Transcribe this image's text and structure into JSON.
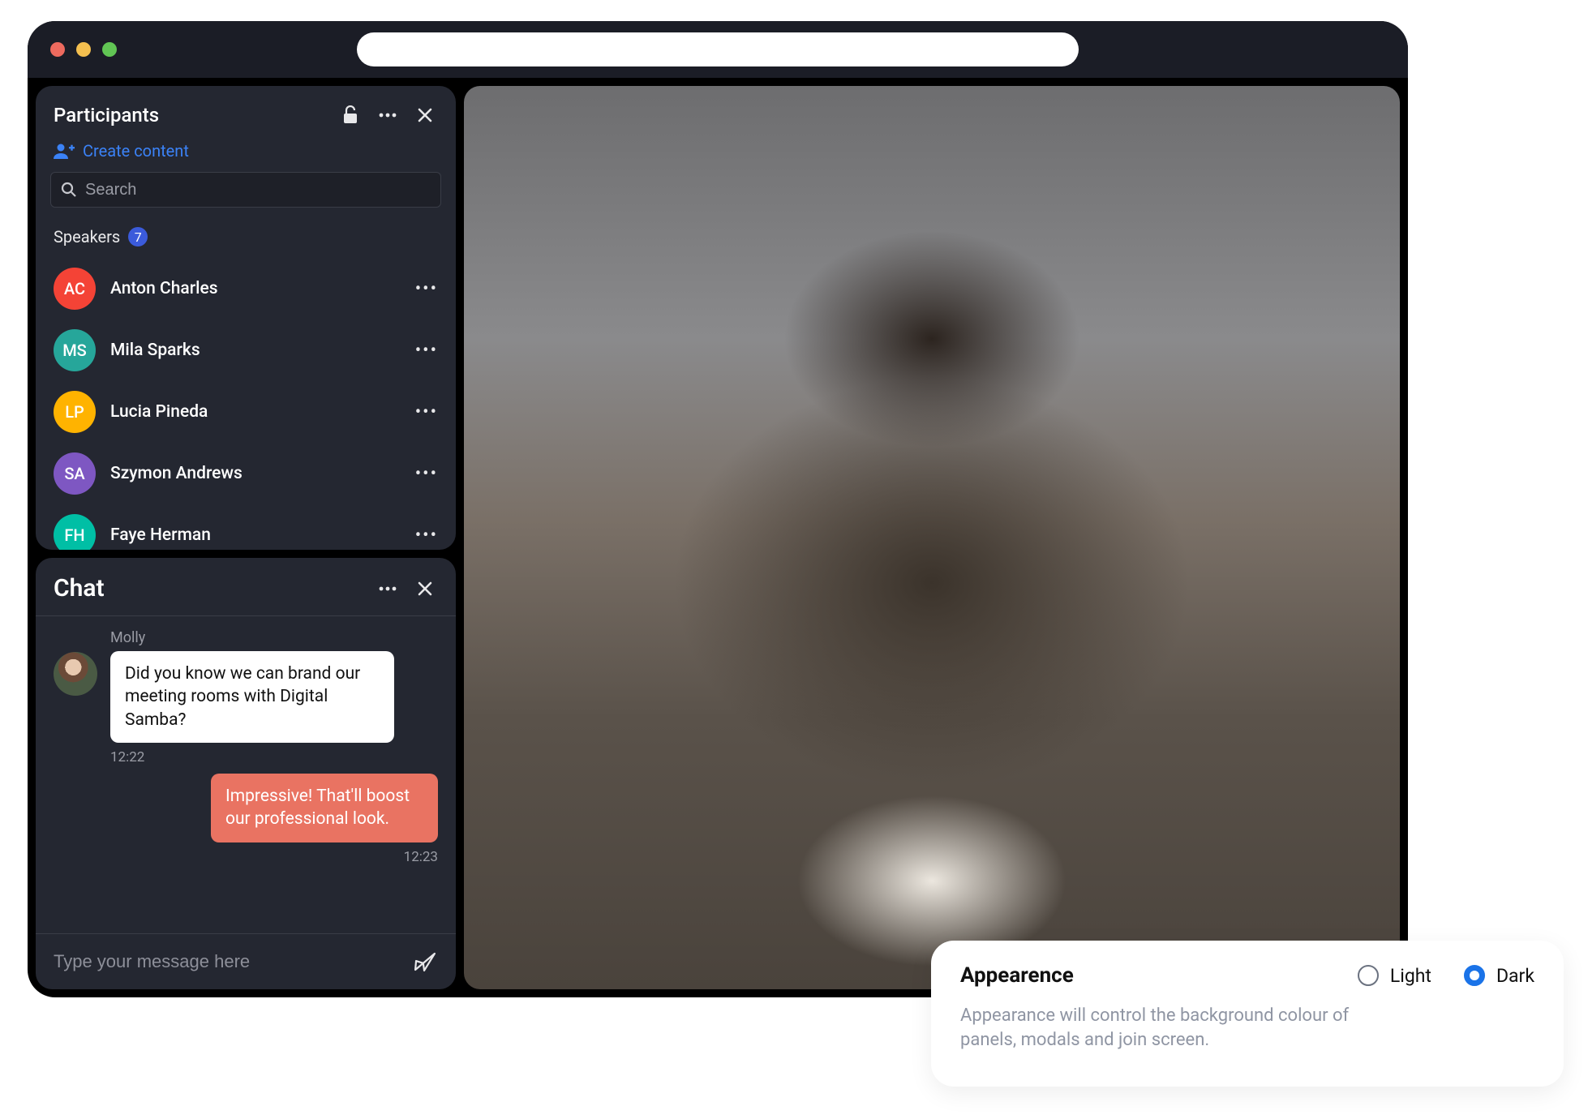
{
  "participants": {
    "title": "Participants",
    "create_label": "Create content",
    "search_placeholder": "Search",
    "section_label": "Speakers",
    "count": "7",
    "list": [
      {
        "initials": "AC",
        "name": "Anton Charles",
        "color": "#f44336"
      },
      {
        "initials": "MS",
        "name": "Mila Sparks",
        "color": "#26a69a"
      },
      {
        "initials": "LP",
        "name": "Lucia Pineda",
        "color": "#ffb300"
      },
      {
        "initials": "SA",
        "name": "Szymon Andrews",
        "color": "#7e57c2"
      },
      {
        "initials": "FH",
        "name": "Faye Herman",
        "color": "#00bfa5"
      }
    ]
  },
  "chat": {
    "title": "Chat",
    "messages": {
      "0": {
        "author": "Molly",
        "text": "Did you know we can brand our meeting rooms with Digital Samba?",
        "time": "12:22"
      },
      "1": {
        "text": "Impressive! That'll boost our professional look.",
        "time": "12:23"
      }
    },
    "input_placeholder": "Type your message here"
  },
  "appearance": {
    "title": "Appearence",
    "option_light": "Light",
    "option_dark": "Dark",
    "description": "Appearance will control the background colour of panels, modals and join screen."
  }
}
